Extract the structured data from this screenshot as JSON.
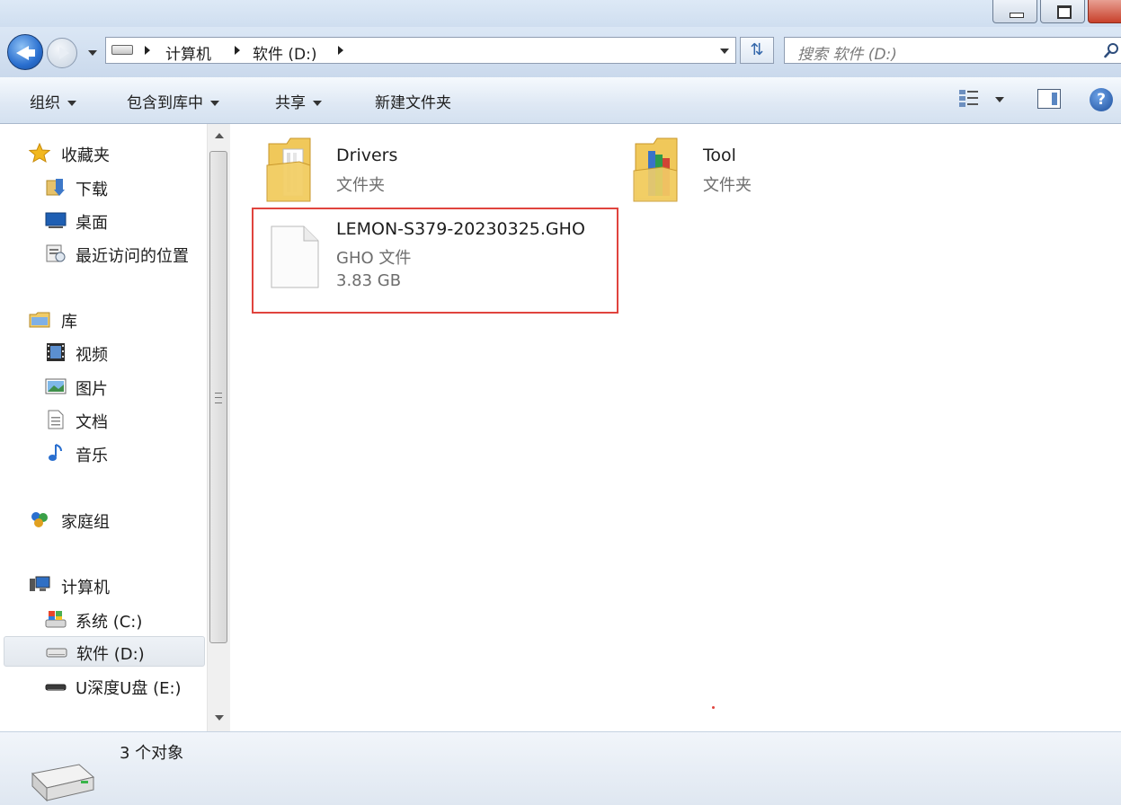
{
  "address_bar": {
    "crumbs": [
      "计算机",
      "软件 (D:)"
    ]
  },
  "search": {
    "placeholder": "搜索 软件 (D:)"
  },
  "toolbar": {
    "organize": "组织",
    "include_in_library": "包含到库中",
    "share": "共享",
    "new_folder": "新建文件夹"
  },
  "sidebar": {
    "favorites": {
      "label": "收藏夹",
      "items": [
        "下载",
        "桌面",
        "最近访问的位置"
      ]
    },
    "libraries": {
      "label": "库",
      "items": [
        "视频",
        "图片",
        "文档",
        "音乐"
      ]
    },
    "homegroup": "家庭组",
    "computer": {
      "label": "计算机",
      "items": [
        "系统 (C:)",
        "软件 (D:)",
        "U深度U盘 (E:)"
      ]
    }
  },
  "files": [
    {
      "name": "Drivers",
      "type": "文件夹"
    },
    {
      "name": "Tool",
      "type": "文件夹"
    },
    {
      "name": "LEMON-S379-20230325.GHO",
      "type": "GHO 文件",
      "size": "3.83 GB"
    }
  ],
  "status": {
    "item_count": "3 个对象"
  },
  "colors": {
    "highlight_border": "#e0443e",
    "toolbar_gradient_end": "#d4e1f0"
  }
}
